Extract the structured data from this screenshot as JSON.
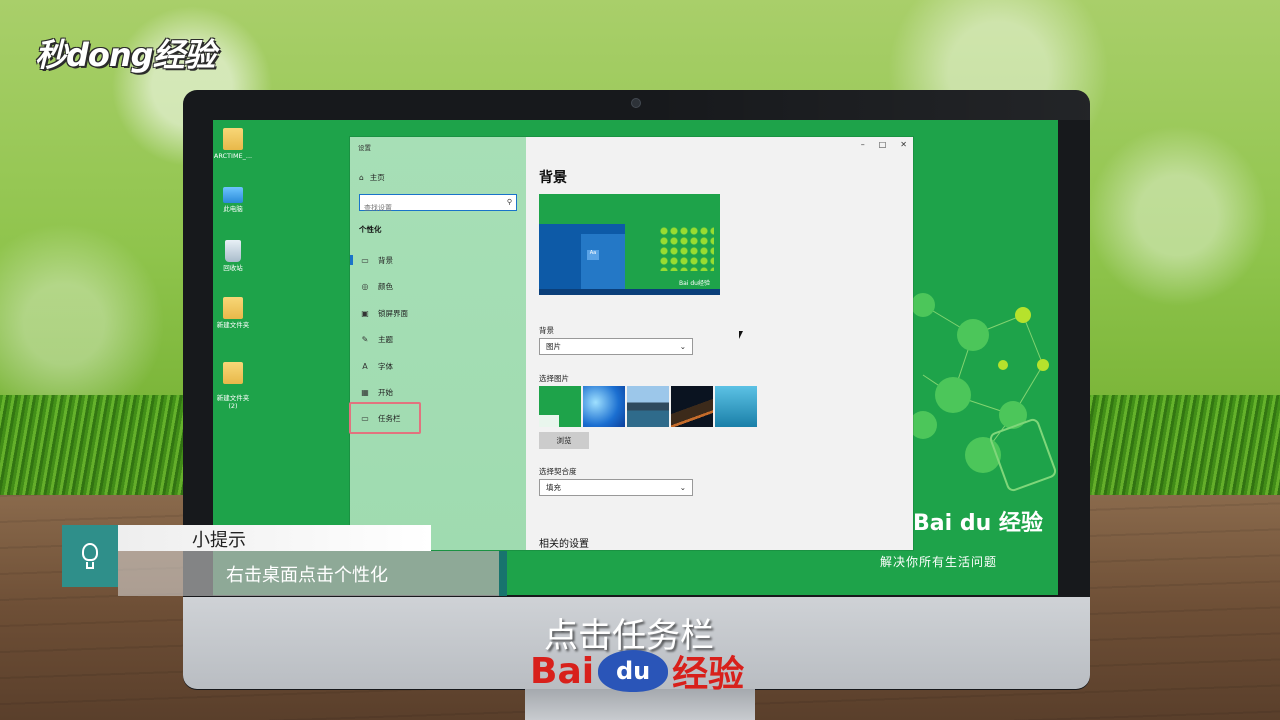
{
  "watermark": {
    "brand": "秒dong经验"
  },
  "desktop": {
    "icons": [
      {
        "label": "ARCTIME_..."
      },
      {
        "label": "此电脑"
      },
      {
        "label": "回收站"
      },
      {
        "label": "新建文件夹"
      },
      {
        "label": "新建文件夹\n(2)"
      }
    ],
    "wallpaper_brand": "Bai du 经验",
    "wallpaper_slogan": "解决你所有生活问题"
  },
  "settings": {
    "title": "设置",
    "home": "主页",
    "search_placeholder": "查找设置",
    "section": "个性化",
    "nav": [
      {
        "label": "背景",
        "icon": "image-icon",
        "glyph": "▭"
      },
      {
        "label": "颜色",
        "icon": "palette-icon",
        "glyph": "◎"
      },
      {
        "label": "锁屏界面",
        "icon": "lock-screen-icon",
        "glyph": "▣"
      },
      {
        "label": "主题",
        "icon": "theme-icon",
        "glyph": "✎"
      },
      {
        "label": "字体",
        "icon": "font-icon",
        "glyph": "A"
      },
      {
        "label": "开始",
        "icon": "start-icon",
        "glyph": "▦"
      },
      {
        "label": "任务栏",
        "icon": "taskbar-icon",
        "glyph": "▭"
      }
    ],
    "content": {
      "page_title": "背景",
      "preview_tile": "Aa",
      "preview_brand": "Bai du经验",
      "background_label": "背景",
      "background_value": "图片",
      "choose_picture_label": "选择图片",
      "browse_button": "浏览",
      "fit_label": "选择契合度",
      "fit_value": "填充",
      "related_settings": "相关的设置"
    },
    "window_controls": {
      "minimize": "–",
      "maximize": "□",
      "close": "✕"
    }
  },
  "tip": {
    "title": "小提示",
    "body": "右击桌面点击个性化"
  },
  "subtitle": "点击任务栏",
  "bottom_logo": {
    "bai": "Bai",
    "du": "du",
    "jingyan": "经验"
  },
  "colors": {
    "desktop_green": "#1ea34a",
    "sidebar_green": "#a7dfb6",
    "highlight_red": "#e2737e",
    "tip_teal": "#2f8f8a",
    "baidu_red": "#d8201b",
    "baidu_blue": "#2a55b8"
  }
}
